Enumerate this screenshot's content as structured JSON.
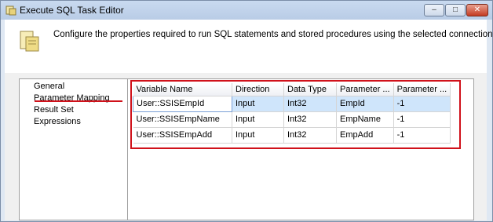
{
  "window": {
    "title": "Execute SQL Task Editor",
    "controls": {
      "minimize_icon": "minimize-icon",
      "maximize_icon": "maximize-icon",
      "close_icon": "close-icon"
    }
  },
  "header": {
    "description": "Configure the properties required to run SQL statements and stored procedures using the selected connection."
  },
  "nav": {
    "items": [
      {
        "label": "General",
        "selected": false
      },
      {
        "label": "Parameter Mapping",
        "selected": true
      },
      {
        "label": "Result Set",
        "selected": false
      },
      {
        "label": "Expressions",
        "selected": false
      }
    ]
  },
  "grid": {
    "columns": [
      "Variable Name",
      "Direction",
      "Data Type",
      "Parameter ...",
      "Parameter ..."
    ],
    "rows": [
      [
        "User::SSISEmpId",
        "Input",
        "Int32",
        "EmpId",
        "-1"
      ],
      [
        "User::SSISEmpName",
        "Input",
        "Int32",
        "EmpName",
        "-1"
      ],
      [
        "User::SSISEmpAdd",
        "Input",
        "Int32",
        "EmpAdd",
        "-1"
      ]
    ],
    "selected_row": 0
  },
  "colors": {
    "annotation_red": "#d0111a",
    "selection_blue": "#cfe5fb"
  }
}
